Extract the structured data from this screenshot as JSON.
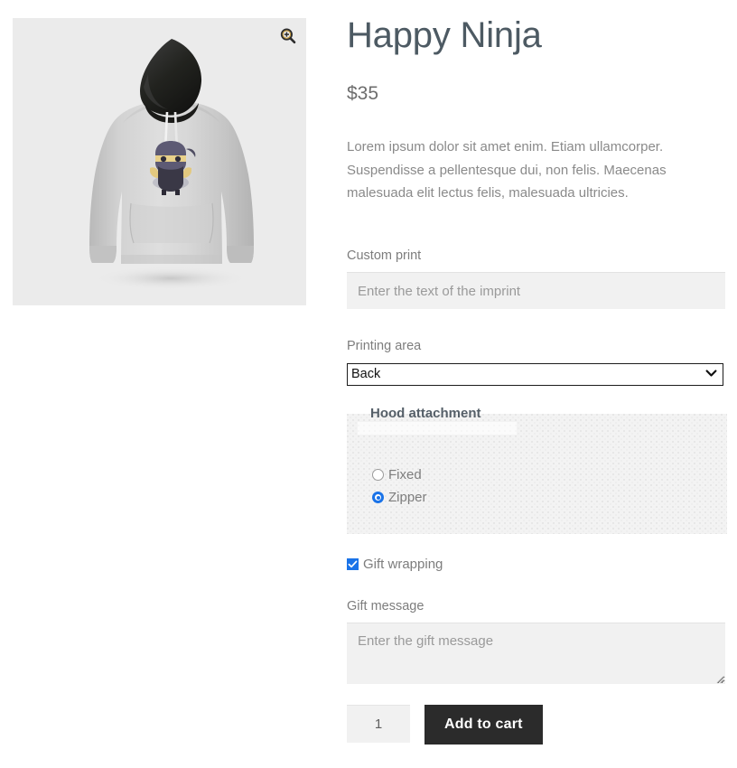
{
  "product": {
    "title": "Happy Ninja",
    "price": "$35",
    "description": "Lorem ipsum dolor sit amet enim. Etiam ullamcorper. Suspendisse a pellentesque dui, non felis. Maecenas malesuada elit lectus felis, malesuada ultricies.",
    "image_alt": "Happy Ninja grey hoodie with black hood"
  },
  "gallery": {
    "zoom_icon": "zoom-in-magnifier-icon"
  },
  "form": {
    "custom_print": {
      "label": "Custom print",
      "value": "",
      "placeholder": "Enter the text of the imprint"
    },
    "printing_area": {
      "label": "Printing area",
      "selected": "Back",
      "options": [
        "Back"
      ],
      "arrow_icon": "chevron-down-icon"
    },
    "hood_attachment": {
      "legend": "Hood attachment",
      "options": [
        {
          "label": "Fixed",
          "selected": false
        },
        {
          "label": "Zipper",
          "selected": true
        }
      ]
    },
    "gift_wrapping": {
      "label": "Gift wrapping",
      "checked": true,
      "check_icon": "checkmark-icon"
    },
    "gift_message": {
      "label": "Gift message",
      "value": "",
      "placeholder": "Enter the gift message"
    },
    "quantity": {
      "value": "1"
    },
    "add_to_cart": {
      "label": "Add to cart"
    }
  },
  "colors": {
    "accent_blue": "#1a73e8",
    "button_dark": "#2b2b2b",
    "field_grey": "#f1f1f1",
    "gallery_grey": "#ebebeb",
    "title_grey": "#4d5a63",
    "body_grey": "#8a8a8a"
  }
}
